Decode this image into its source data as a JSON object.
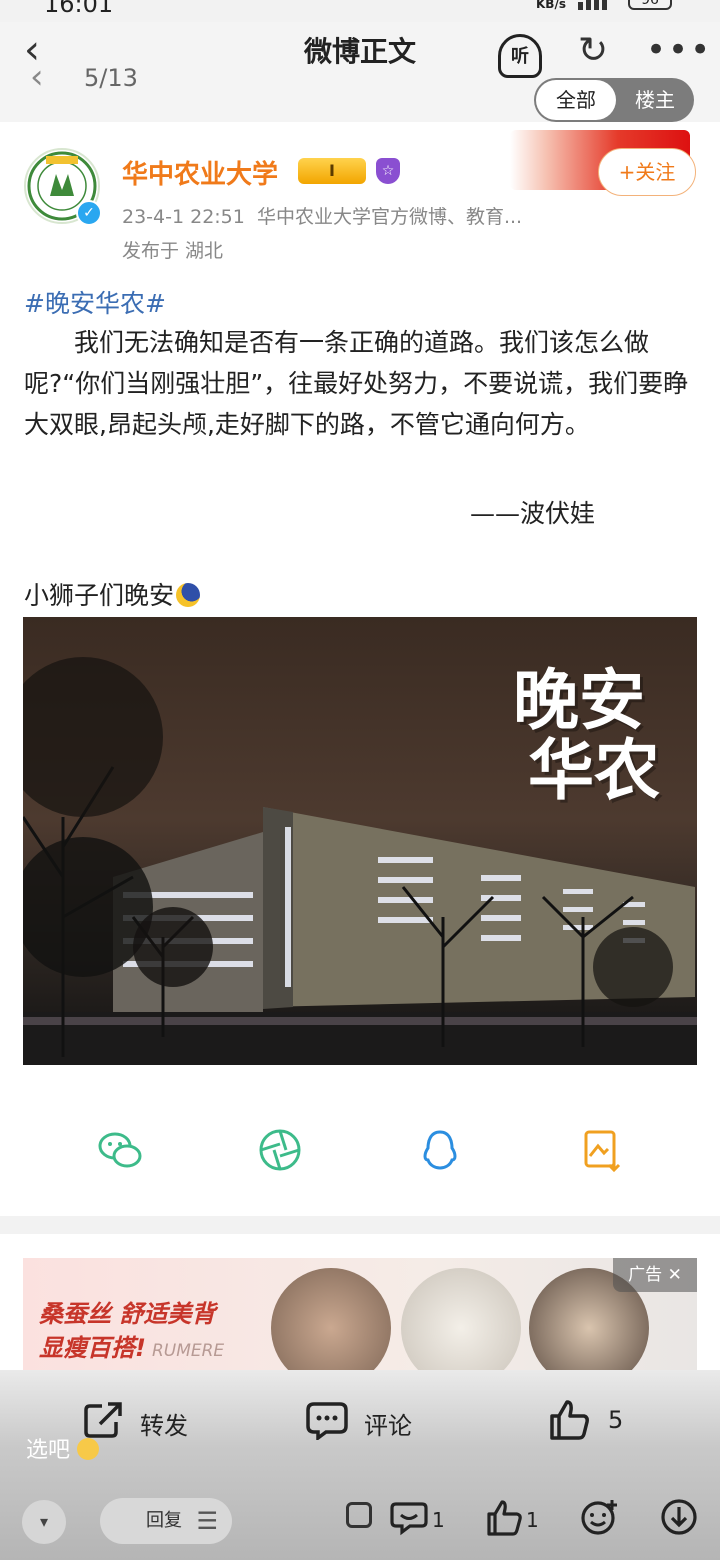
{
  "status": {
    "time": "16:01",
    "speed_unit": "KB/s",
    "battery": "96"
  },
  "header": {
    "title": "微博正文",
    "page_index": "5/13",
    "listen_label": "听",
    "segments": [
      "全部",
      "楼主"
    ]
  },
  "author": {
    "name": "华中农业大学",
    "badge_level": "I",
    "date": "23-4-1 22:51",
    "desc": "华中农业大学官方微博、教育...",
    "location": "发布于 湖北",
    "follow_label": "+关注"
  },
  "post": {
    "hashtag": "#晚安华农#",
    "paragraph": "我们无法确知是否有一条正确的道路。我们该怎么做呢?“你们当刚强壮胆”，往最好处努力，不要说谎，我们要睁大双眼,昂起头颅,走好脚下的路，不管它通向何方。",
    "signature": "——波伏娃",
    "caption": "小狮子们晚安",
    "image_text": [
      "晚安",
      "华农"
    ]
  },
  "ad": {
    "line1": "桑蚕丝 舒适美背",
    "line2": "显瘦百搭!",
    "brand": "RUMERE",
    "tag": "广告 ✕"
  },
  "actions": {
    "repost": "转发",
    "comment": "评论",
    "like_count": "5"
  },
  "overlay_text": "选吧",
  "bottom_bar": {
    "reply_label": "回复",
    "comment_count": "1",
    "like_count": "1"
  },
  "colors": {
    "accent": "#f07a1a",
    "link": "#3b6db3",
    "share_green": "#3dbb8a",
    "share_blue": "#2b8ee0",
    "share_orange": "#f0a020"
  }
}
